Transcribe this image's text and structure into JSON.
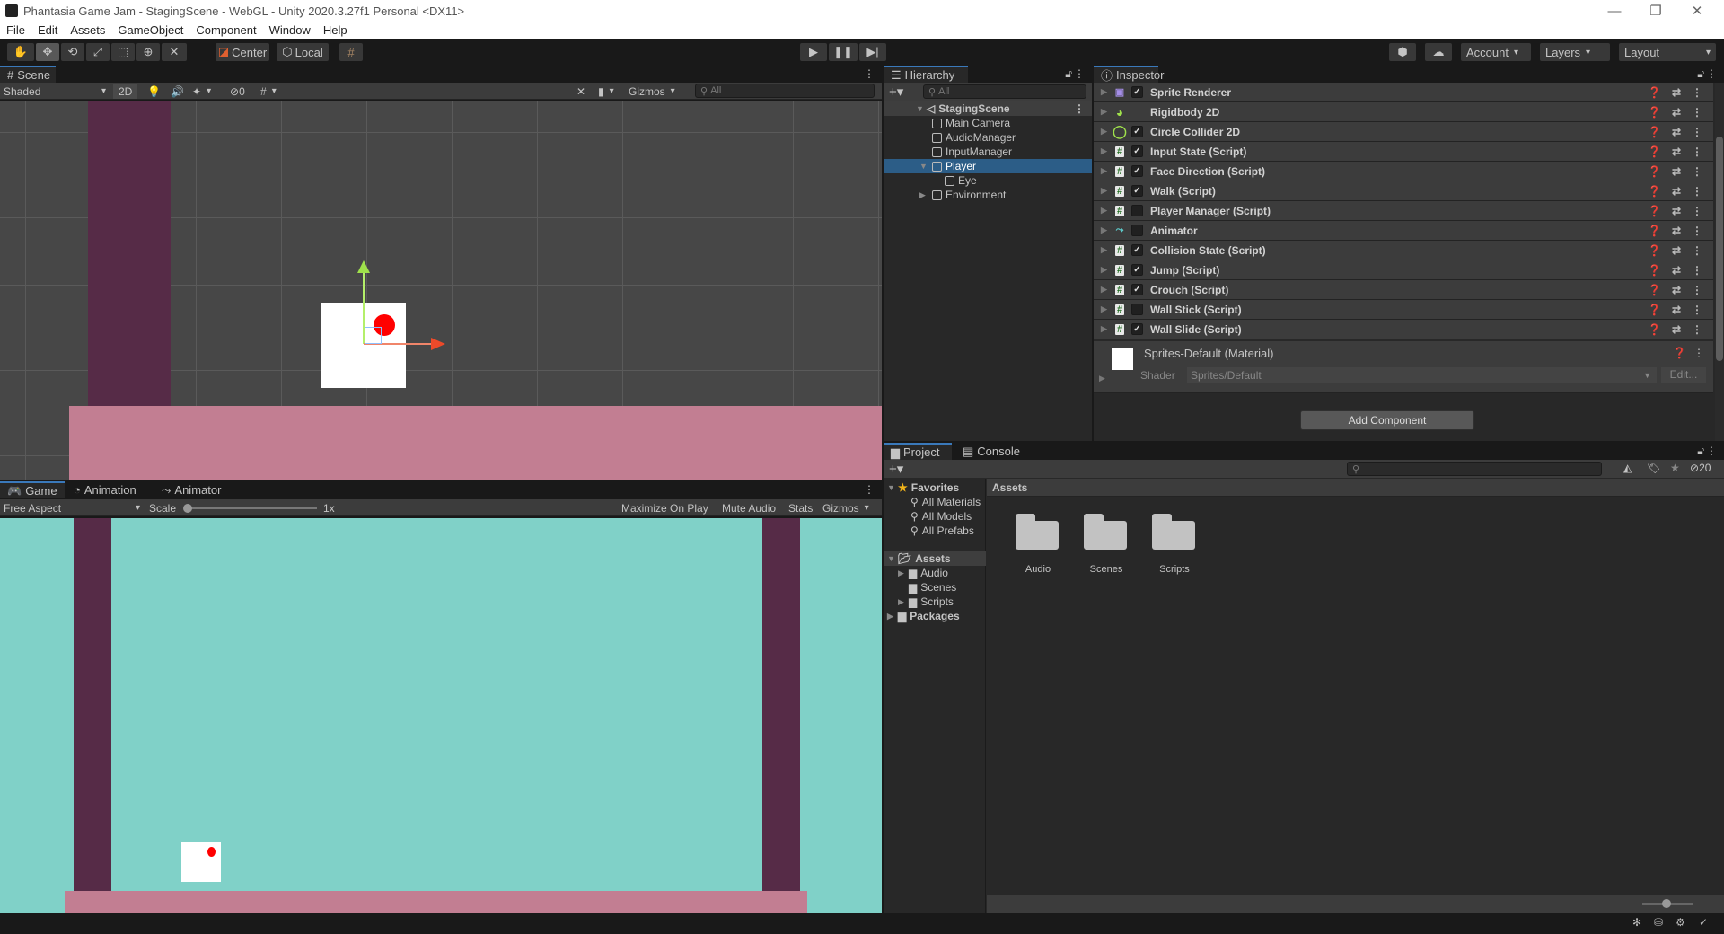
{
  "window": {
    "title": "Phantasia Game Jam - StagingScene - WebGL - Unity 2020.3.27f1 Personal <DX11>",
    "controls": [
      "minimize",
      "restore",
      "close"
    ]
  },
  "menu": [
    "File",
    "Edit",
    "Assets",
    "GameObject",
    "Component",
    "Window",
    "Help"
  ],
  "toolbar": {
    "tools": [
      "hand-tool",
      "move-tool",
      "rotate-tool",
      "scale-tool",
      "rect-tool",
      "transform-tool",
      "custom-tool"
    ],
    "pivot_label": "Center",
    "space_label": "Local",
    "play_controls": [
      "play",
      "pause",
      "step"
    ],
    "account_label": "Account",
    "layers_label": "Layers",
    "layout_label": "Layout"
  },
  "scene": {
    "tab_label": "Scene",
    "shading_mode": "Shaded",
    "mode_2d_label": "2D",
    "hidden_count": "0",
    "gizmos_label": "Gizmos",
    "search_placeholder": "All"
  },
  "game": {
    "tabs": [
      "Game",
      "Animation",
      "Animator"
    ],
    "aspect": "Free Aspect",
    "scale_label": "Scale",
    "scale_value": "1x",
    "buttons": [
      "Maximize On Play",
      "Mute Audio",
      "Stats",
      "Gizmos"
    ]
  },
  "hierarchy": {
    "tab_label": "Hierarchy",
    "search_placeholder": "All",
    "scene_name": "StagingScene",
    "items": [
      {
        "label": "Main Camera",
        "depth": 1,
        "expand": ""
      },
      {
        "label": "AudioManager",
        "depth": 1,
        "expand": ""
      },
      {
        "label": "InputManager",
        "depth": 1,
        "expand": ""
      },
      {
        "label": "Player",
        "depth": 1,
        "expand": "▼",
        "selected": true
      },
      {
        "label": "Eye",
        "depth": 2,
        "expand": ""
      },
      {
        "label": "Environment",
        "depth": 1,
        "expand": "▶"
      }
    ]
  },
  "inspector": {
    "tab_label": "Inspector",
    "components": [
      {
        "name": "Sprite Renderer",
        "icon": "sprite-renderer",
        "enabled": true,
        "has_checkbox": true
      },
      {
        "name": "Rigidbody 2D",
        "icon": "rigidbody",
        "enabled": null,
        "has_checkbox": false
      },
      {
        "name": "Circle Collider 2D",
        "icon": "collider",
        "enabled": true,
        "has_checkbox": true
      },
      {
        "name": "Input State (Script)",
        "icon": "script",
        "enabled": true,
        "has_checkbox": true
      },
      {
        "name": "Face Direction (Script)",
        "icon": "script",
        "enabled": true,
        "has_checkbox": true
      },
      {
        "name": "Walk (Script)",
        "icon": "script",
        "enabled": true,
        "has_checkbox": true
      },
      {
        "name": "Player Manager (Script)",
        "icon": "script",
        "enabled": false,
        "has_checkbox": true
      },
      {
        "name": "Animator",
        "icon": "animator",
        "enabled": false,
        "has_checkbox": true
      },
      {
        "name": "Collision State (Script)",
        "icon": "script",
        "enabled": true,
        "has_checkbox": true
      },
      {
        "name": "Jump (Script)",
        "icon": "script",
        "enabled": true,
        "has_checkbox": true
      },
      {
        "name": "Crouch (Script)",
        "icon": "script",
        "enabled": true,
        "has_checkbox": true
      },
      {
        "name": "Wall Stick (Script)",
        "icon": "script",
        "enabled": false,
        "has_checkbox": true
      },
      {
        "name": "Wall Slide (Script)",
        "icon": "script",
        "enabled": true,
        "has_checkbox": true
      }
    ],
    "material": {
      "name": "Sprites-Default (Material)",
      "shader_label": "Shader",
      "shader_value": "Sprites/Default",
      "edit_label": "Edit..."
    },
    "add_component_label": "Add Component"
  },
  "project": {
    "tabs": [
      "Project",
      "Console"
    ],
    "favorites_label": "Favorites",
    "favorites": [
      "All Materials",
      "All Models",
      "All Prefabs"
    ],
    "assets_label": "Assets",
    "asset_tree": [
      {
        "label": "Audio",
        "expand": "▶"
      },
      {
        "label": "Scenes",
        "expand": ""
      },
      {
        "label": "Scripts",
        "expand": "▶"
      }
    ],
    "packages_label": "Packages",
    "breadcrumb": "Assets",
    "folders": [
      "Audio",
      "Scenes",
      "Scripts"
    ],
    "hidden_count": "20"
  },
  "colors": {
    "scene_bg": "#474747",
    "game_bg": "#80d1c8",
    "wall": "#562b47",
    "floor": "#c27e92",
    "player": "#ffffff",
    "eye": "#ff0000",
    "selection": "#2c5d87"
  }
}
